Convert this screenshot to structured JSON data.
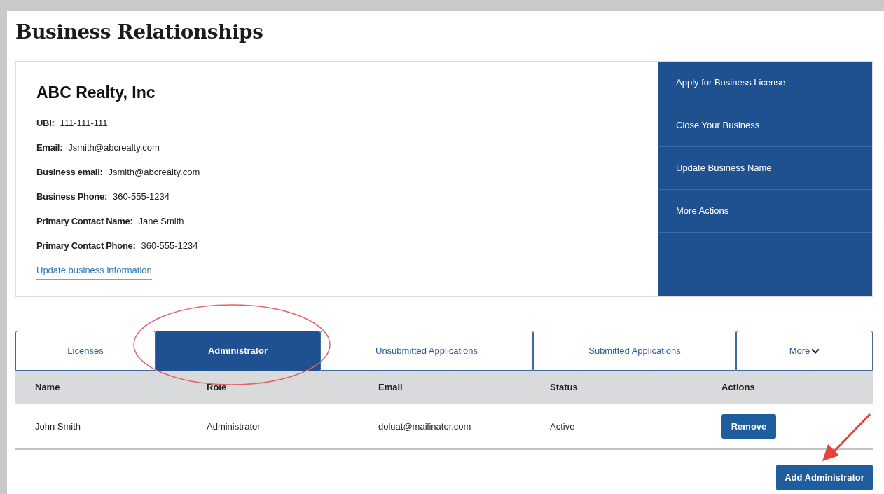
{
  "page_title": "Business Relationships",
  "business": {
    "name": "ABC Realty, Inc",
    "fields": [
      {
        "label": "UBI:",
        "value": "111-111-111"
      },
      {
        "label": "Email:",
        "value": "Jsmith@abcrealty.com"
      },
      {
        "label": "Business email:",
        "value": "Jsmith@abcrealty.com"
      },
      {
        "label": "Business Phone:",
        "value": "360-555-1234"
      },
      {
        "label": "Primary Contact Name:",
        "value": "Jane Smith"
      },
      {
        "label": "Primary Contact Phone:",
        "value": "360-555-1234"
      }
    ],
    "update_link": "Update business information"
  },
  "actions": [
    "Apply for Business License",
    "Close Your Business",
    "Update Business Name",
    "More Actions"
  ],
  "tabs": [
    {
      "label": "Licenses",
      "selected": false,
      "has_menu": false
    },
    {
      "label": "Administrator",
      "selected": true,
      "has_menu": false
    },
    {
      "label": "Unsubmitted Applications",
      "selected": false,
      "has_menu": false
    },
    {
      "label": "Submitted Applications",
      "selected": false,
      "has_menu": false
    },
    {
      "label": "More",
      "selected": false,
      "has_menu": true
    }
  ],
  "table": {
    "columns": [
      "Name",
      "Role",
      "Email",
      "Status",
      "Actions"
    ],
    "rows": [
      {
        "name": "John Smith",
        "role": "Administrator",
        "email": "doluat@mailinator.com",
        "status": "Active",
        "action": "Remove"
      }
    ]
  },
  "add_button": "Add Administrator"
}
